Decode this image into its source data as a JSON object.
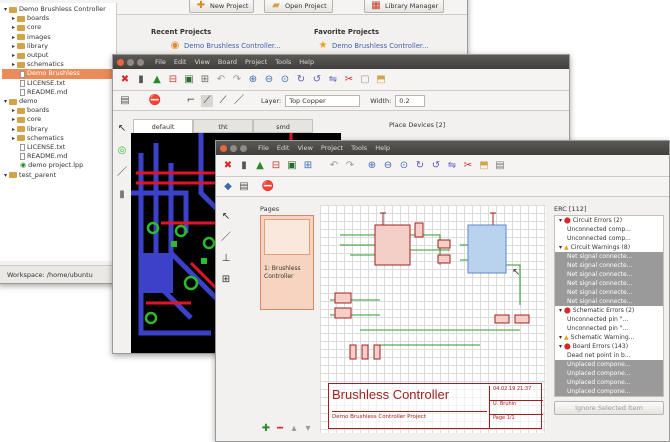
{
  "control_panel": {
    "buttons": {
      "new_project": "New Project",
      "open_project": "Open Project",
      "library_manager": "Library Manager"
    },
    "recent_title": "Recent Projects",
    "recent_item": "Demo Brushless Controller...",
    "favorite_title": "Favorite Projects",
    "favorite_item": "Demo Brushless Controller...",
    "status": "Workspace: /home/ubuntu",
    "tree": [
      {
        "label": "Demo Brushless Controller",
        "type": "folder",
        "indent": 0
      },
      {
        "label": "boards",
        "type": "folder",
        "indent": 1
      },
      {
        "label": "core",
        "type": "folder",
        "indent": 1
      },
      {
        "label": "images",
        "type": "folder",
        "indent": 1
      },
      {
        "label": "library",
        "type": "folder",
        "indent": 1
      },
      {
        "label": "output",
        "type": "folder",
        "indent": 1
      },
      {
        "label": "schematics",
        "type": "folder",
        "indent": 1
      },
      {
        "label": "Demo Brushless",
        "type": "file",
        "indent": 2,
        "selected": true
      },
      {
        "label": "LICENSE.txt",
        "type": "file",
        "indent": 2
      },
      {
        "label": "README.md",
        "type": "file",
        "indent": 2
      },
      {
        "label": "demo",
        "type": "folder",
        "indent": 0
      },
      {
        "label": "boards",
        "type": "folder",
        "indent": 1
      },
      {
        "label": "core",
        "type": "folder",
        "indent": 1
      },
      {
        "label": "library",
        "type": "folder",
        "indent": 1
      },
      {
        "label": "schematics",
        "type": "folder",
        "indent": 1
      },
      {
        "label": "LICENSE.txt",
        "type": "file",
        "indent": 2
      },
      {
        "label": "README.md",
        "type": "file",
        "indent": 2
      },
      {
        "label": "demo project.lpp",
        "type": "project",
        "indent": 2
      },
      {
        "label": "test_parent",
        "type": "folder",
        "indent": 0
      }
    ]
  },
  "board_editor": {
    "menu": [
      "File",
      "Edit",
      "View",
      "Board",
      "Project",
      "Tools",
      "Help"
    ],
    "layer_label": "Layer:",
    "layer_value": "Top Copper",
    "width_label": "Width:",
    "width_value": "0.2",
    "tabs": [
      "default",
      "tht",
      "smd"
    ],
    "dock_title": "Place Devices [2]"
  },
  "schematic_editor": {
    "menu": [
      "File",
      "Edit",
      "View",
      "Project",
      "Tools",
      "Help"
    ],
    "pages_title": "Pages",
    "page_name": "1: Brushless Controller",
    "title_block": {
      "title": "Brushless Controller",
      "subtitle": "Demo Brushless Controller Project",
      "date": "04.02.19 21:37",
      "author": "U. Bruhin",
      "page": "Page 1/1"
    },
    "erc_title": "ERC [112]",
    "erc_items": [
      {
        "label": "Circuit Errors (2)",
        "kind": "error-head"
      },
      {
        "label": "Unconnected comp...",
        "kind": "item"
      },
      {
        "label": "Unconnected comp...",
        "kind": "item"
      },
      {
        "label": "Circuit Warnings (8)",
        "kind": "warn-head"
      },
      {
        "label": "Net signal connecte...",
        "kind": "grey"
      },
      {
        "label": "Net signal connecte...",
        "kind": "grey"
      },
      {
        "label": "Net signal connecte...",
        "kind": "grey"
      },
      {
        "label": "Net signal connecte...",
        "kind": "grey"
      },
      {
        "label": "Net signal connecte...",
        "kind": "grey"
      },
      {
        "label": "Net signal connecte...",
        "kind": "grey"
      },
      {
        "label": "Schematic Errors (2)",
        "kind": "error-head"
      },
      {
        "label": "Unconnected pin \"...",
        "kind": "item"
      },
      {
        "label": "Unconnected pin \"...",
        "kind": "item"
      },
      {
        "label": "Schematic Warning...",
        "kind": "warn-head"
      },
      {
        "label": "Board Errors (143)",
        "kind": "error-head"
      },
      {
        "label": "Dead net point in b...",
        "kind": "item"
      },
      {
        "label": "Unplaced compone...",
        "kind": "grey"
      },
      {
        "label": "Unplaced compone...",
        "kind": "grey"
      },
      {
        "label": "Unplaced compone...",
        "kind": "grey"
      },
      {
        "label": "Unplaced compone...",
        "kind": "grey"
      }
    ],
    "ignore_button": "Ignore Selected Item"
  },
  "colors": {
    "pcb_bg": "#000000",
    "pcb_copper": "#e3142a",
    "pcb_bottom": "#3b42c9",
    "pcb_pad": "#2bbd2b",
    "titlebar": "#403f3b",
    "error": "#d9262a",
    "warning": "#f0a018"
  }
}
